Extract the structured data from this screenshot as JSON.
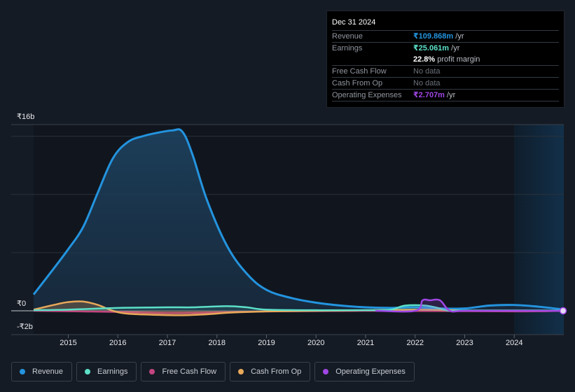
{
  "tooltip": {
    "date": "Dec 31 2024",
    "rows": [
      {
        "label": "Revenue",
        "value": "₹109.868m",
        "unit": " /yr",
        "color": "#2394df"
      },
      {
        "label": "Earnings",
        "value": "₹25.061m",
        "unit": " /yr",
        "color": "#5ce0c8"
      },
      {
        "label": "",
        "value": "22.8%",
        "unit": " profit margin",
        "color": "#ffffff"
      },
      {
        "label": "Free Cash Flow",
        "value": "No data",
        "unit": "",
        "color": "#6b717a"
      },
      {
        "label": "Cash From Op",
        "value": "No data",
        "unit": "",
        "color": "#6b717a"
      },
      {
        "label": "Operating Expenses",
        "value": "₹2.707m",
        "unit": " /yr",
        "color": "#a046e6"
      }
    ]
  },
  "legend": [
    {
      "label": "Revenue",
      "color": "#2394df"
    },
    {
      "label": "Earnings",
      "color": "#5ce0c8"
    },
    {
      "label": "Free Cash Flow",
      "color": "#c2457f"
    },
    {
      "label": "Cash From Op",
      "color": "#e8a95a"
    },
    {
      "label": "Operating Expenses",
      "color": "#a046e6"
    }
  ],
  "chart_data": {
    "type": "area",
    "title": "",
    "xlabel": "",
    "ylabel": "",
    "y_tick_labels": [
      "₹16b",
      "₹0",
      "-₹2b"
    ],
    "x_tick_labels": [
      "2015",
      "2016",
      "2017",
      "2018",
      "2019",
      "2020",
      "2021",
      "2022",
      "2023",
      "2024"
    ],
    "ylim": [
      -2,
      16
    ],
    "xlim": [
      2014.3,
      2025.0
    ],
    "units": "₹ billions",
    "grid": true,
    "legend_position": "bottom",
    "forecast_region_start": 2024.0,
    "series": [
      {
        "name": "Revenue",
        "color": "#2394df",
        "x": [
          2014.3,
          2014.7,
          2015.0,
          2015.3,
          2015.6,
          2015.9,
          2016.2,
          2016.5,
          2016.8,
          2017.1,
          2017.3,
          2017.5,
          2017.8,
          2018.2,
          2018.6,
          2019.0,
          2019.5,
          2020.0,
          2020.5,
          2021.0,
          2021.5,
          2022.0,
          2022.5,
          2023.0,
          2023.5,
          2024.0,
          2024.5,
          2025.0
        ],
        "y": [
          1.4,
          3.6,
          5.3,
          7.2,
          10.2,
          13.1,
          14.5,
          15.0,
          15.3,
          15.5,
          15.4,
          13.5,
          9.5,
          5.6,
          3.2,
          1.8,
          1.1,
          0.7,
          0.45,
          0.3,
          0.25,
          0.3,
          0.2,
          0.2,
          0.45,
          0.5,
          0.35,
          0.11
        ]
      },
      {
        "name": "Earnings",
        "color": "#5ce0c8",
        "x": [
          2014.3,
          2015.0,
          2016.0,
          2017.0,
          2017.5,
          2018.2,
          2018.6,
          2019.0,
          2020.0,
          2021.0,
          2021.5,
          2021.8,
          2022.2,
          2022.5,
          2022.7,
          2023.0,
          2024.0,
          2025.0
        ],
        "y": [
          0.05,
          0.1,
          0.25,
          0.3,
          0.3,
          0.4,
          0.3,
          0.1,
          0.05,
          0.05,
          0.1,
          0.45,
          0.45,
          0.2,
          0.0,
          0.03,
          0.03,
          0.025
        ]
      },
      {
        "name": "Free Cash Flow",
        "color": "#c2457f",
        "x": [
          2014.3,
          2016.0,
          2017.0,
          2018.0,
          2019.0,
          2021.0,
          2024.0,
          2025.0
        ],
        "y": [
          0.0,
          -0.1,
          -0.2,
          -0.15,
          -0.05,
          0.0,
          -0.05,
          0.0
        ]
      },
      {
        "name": "Cash From Op",
        "color": "#e8a95a",
        "x": [
          2014.3,
          2014.7,
          2015.0,
          2015.3,
          2015.6,
          2015.9,
          2016.2,
          2016.8,
          2017.3,
          2017.8,
          2018.3,
          2019.0,
          2020.0,
          2021.0,
          2022.0,
          2022.7,
          2023.0
        ],
        "y": [
          0.1,
          0.5,
          0.75,
          0.8,
          0.5,
          0.0,
          -0.25,
          -0.35,
          -0.38,
          -0.3,
          -0.15,
          -0.05,
          0.0,
          0.05,
          0.1,
          0.05,
          0.0
        ]
      },
      {
        "name": "Operating Expenses",
        "color": "#a046e6",
        "x": [
          2021.2,
          2022.0,
          2022.15,
          2022.3,
          2022.5,
          2022.7,
          2023.0,
          2024.0,
          2025.0
        ],
        "y": [
          0.0,
          0.0,
          0.9,
          0.9,
          0.9,
          0.0,
          0.0,
          0.0,
          0.003
        ]
      }
    ]
  }
}
